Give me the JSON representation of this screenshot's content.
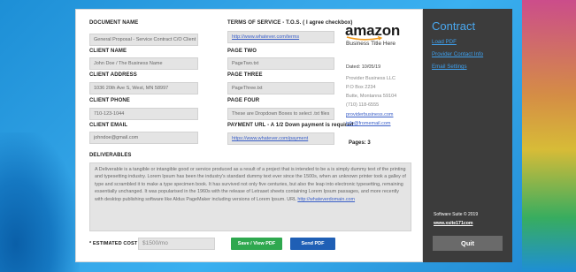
{
  "form": {
    "document_name": {
      "label": "DOCUMENT NAME",
      "value": "General Proposal - Service Contract C/O Client"
    },
    "client_name": {
      "label": "CLIENT NAME",
      "value": "John Doe / The Business Name"
    },
    "client_address": {
      "label": "CLIENT ADDRESS",
      "value": "1036 20th Ave S, West, MN  58997"
    },
    "client_phone": {
      "label": "CLIENT PHONE",
      "value": "710-123-1044"
    },
    "client_email": {
      "label": "CLIENT EMAIL",
      "value": "johndoe@gmail.com"
    },
    "terms": {
      "label": "TERMS OF SERVICE - T.O.S. ( I agree checkbox)",
      "value": "http://www.whatever.com/terms"
    },
    "page_two": {
      "label": "PAGE TWO",
      "value": "PageTwo.txt"
    },
    "page_three": {
      "label": "PAGE THREE",
      "value": "PageThree.txt"
    },
    "page_four": {
      "label": "PAGE FOUR",
      "value": "These are Dropdown Boxes to select .txt files"
    },
    "payment_url": {
      "label": "PAYMENT URL - A 1/2 Down payment is required",
      "value": "https://www.whatever.com/payment"
    },
    "deliverables": {
      "label": "DELIVERABLES",
      "text": "A Deliverable is a tangible or intangible good or service produced as a result of a project that is intended to be a is simply dummy text of the printing and typesetting industry. Lorem Ipsum has been the industry's standard dummy text ever since the 1500s, when an unknown printer took a galley of type and scrambled it to make a type specimen book. It has survived not only five centuries, but also the leap into electronic typesetting, remaining essentially unchanged. It was popularised in the 1960s with the release of Letraset sheets containing Lorem Ipsum passages, and more recently with desktop publishing software like Aldus PageMaker including versions of Lorem Ipsum. URL",
      "url": "http://whateverdomain.com"
    },
    "estimated_cost": {
      "label": "* ESTIMATED COST",
      "value": "$1500/mo"
    },
    "save_button": "Save / View PDF",
    "send_button": "Send PDF"
  },
  "preview": {
    "brand": "amazon",
    "subtitle": "Business Title Here",
    "dated": "Dated:  10/05/19",
    "provider": "Provider Business LLC",
    "po_box": "P.O Box 2234",
    "city": "Butte, Montanna 59104",
    "phone": "(710) 118-6555",
    "website": "providerbusiness.com",
    "email": "info@fromemail.com",
    "pages": "Pages:  3"
  },
  "sidebar": {
    "title": "Contract",
    "links": [
      "Load PDF",
      "Provider Contact Info",
      "Email Settings"
    ],
    "copyright": "Software Suite © 2019",
    "site": "www.xsite171com",
    "quit": "Quit"
  }
}
